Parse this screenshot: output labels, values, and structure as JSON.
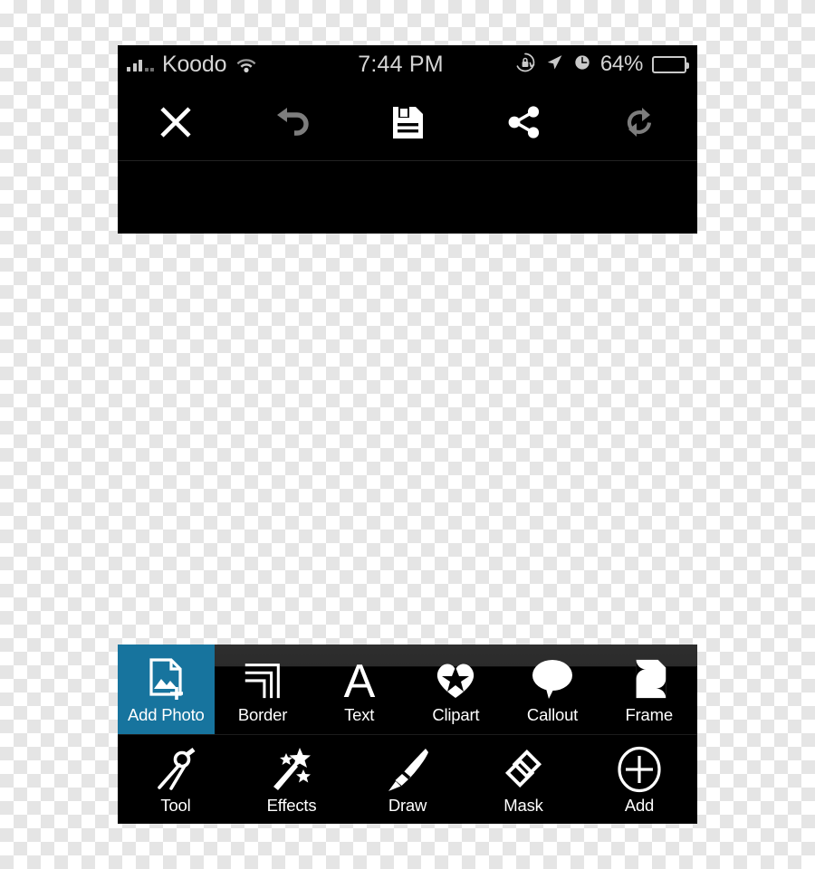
{
  "app": {
    "theme_background": "#000000",
    "accent_color": "#17749e",
    "icon_color": "#ffffff",
    "disabled_icon_color": "#7d7d7d",
    "status_text_color": "#d5d5d5"
  },
  "status_bar": {
    "carrier": "Koodo",
    "signal_bars_filled": 3,
    "signal_bars_total": 5,
    "wifi_icon": "wifi-icon",
    "time": "7:44 PM",
    "rotation_lock_icon": "rotation-lock-icon",
    "location_icon": "location-arrow-icon",
    "alarm_icon": "alarm-clock-icon",
    "battery_percent_label": "64%",
    "battery_level": 64,
    "battery_icon": "battery-icon"
  },
  "toolbar": {
    "buttons": [
      {
        "name": "close-button",
        "icon": "close-x-icon",
        "enabled": true,
        "color": "#ffffff"
      },
      {
        "name": "undo-button",
        "icon": "undo-arrow-icon",
        "enabled": false,
        "color": "#7d7d7d"
      },
      {
        "name": "save-button",
        "icon": "floppy-save-icon",
        "enabled": true,
        "color": "#ffffff"
      },
      {
        "name": "share-button",
        "icon": "share-nodes-icon",
        "enabled": true,
        "color": "#ffffff"
      },
      {
        "name": "redo-button",
        "icon": "redo-refresh-icon",
        "enabled": false,
        "color": "#7d7d7d"
      }
    ]
  },
  "bottom_toolbar": {
    "row1": [
      {
        "label": "Add Photo",
        "icon": "add-photo-icon",
        "active": true
      },
      {
        "label": "Border",
        "icon": "border-corner-icon",
        "active": false
      },
      {
        "label": "Text",
        "icon": "text-letter-a-icon",
        "active": false
      },
      {
        "label": "Clipart",
        "icon": "heart-star-icon",
        "active": false
      },
      {
        "label": "Callout",
        "icon": "speech-bubble-icon",
        "active": false
      },
      {
        "label": "Frame",
        "icon": "frame-icon",
        "active": false
      }
    ],
    "row2": [
      {
        "label": "Tool",
        "icon": "compass-divider-icon",
        "active": false
      },
      {
        "label": "Effects",
        "icon": "magic-wand-icon",
        "active": false
      },
      {
        "label": "Draw",
        "icon": "paintbrush-icon",
        "active": false
      },
      {
        "label": "Mask",
        "icon": "diamond-mask-icon",
        "active": false
      },
      {
        "label": "Add",
        "icon": "plus-circle-icon",
        "active": false
      }
    ]
  }
}
